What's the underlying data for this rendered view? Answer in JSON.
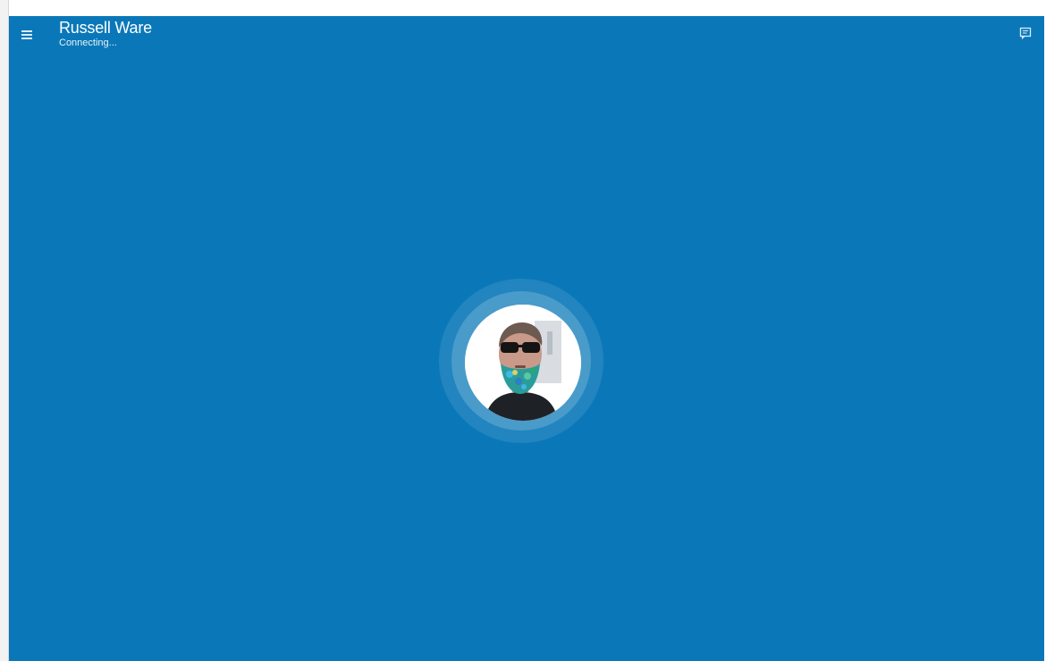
{
  "call": {
    "contact_name": "Russell Ware",
    "status": "Connecting..."
  },
  "icons": {
    "menu": "hamburger-menu-icon",
    "chat": "chat-icon"
  },
  "colors": {
    "background": "#0a78b8",
    "text": "#ffffff"
  }
}
